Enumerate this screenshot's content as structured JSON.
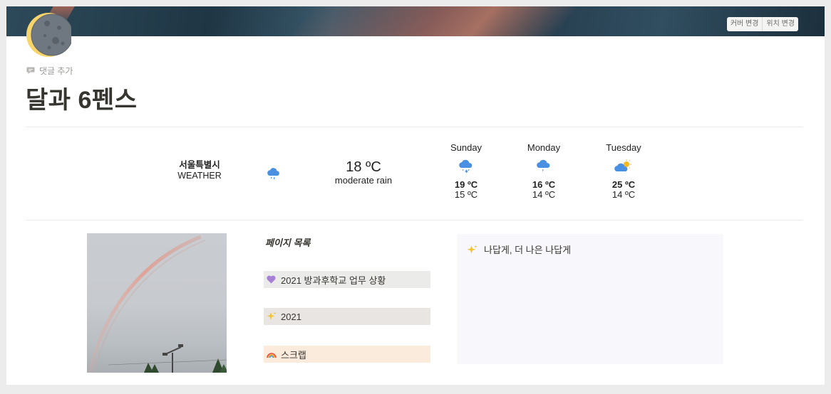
{
  "cover": {
    "change_cover_label": "커버 변경",
    "reposition_label": "위치 변경"
  },
  "page": {
    "icon": "moon-icon",
    "comment_label": "댓글 추가",
    "title": "달과 6펜스"
  },
  "weather": {
    "city": "서울특별시",
    "widget_label": "WEATHER",
    "current": {
      "icon": "rain-cloud-icon",
      "temperature": "18 ºC",
      "description": "moderate rain"
    },
    "forecast": [
      {
        "day": "Sunday",
        "icon": "snow-rain-cloud-icon",
        "high": "19 ºC",
        "low": "15 ºC"
      },
      {
        "day": "Monday",
        "icon": "rain-cloud-icon",
        "high": "16 ºC",
        "low": "14 ºC"
      },
      {
        "day": "Tuesday",
        "icon": "sun-cloud-icon",
        "high": "25 ºC",
        "low": "14 ºC"
      }
    ]
  },
  "toc": {
    "title": "페이지 목록",
    "items": [
      {
        "icon": "purple-heart-icon",
        "label": "2021 방과후학교 업무 상황",
        "bg": "#ebebea"
      },
      {
        "icon": "sparkles-icon",
        "label": "2021",
        "bg": "#e9e5e3"
      },
      {
        "icon": "rainbow-icon",
        "label": "스크랩",
        "bg": "#faebdd"
      }
    ]
  },
  "callout": {
    "icon": "sparkles-icon",
    "text": "나답게, 더 나은 나답게"
  },
  "photo": {
    "subject": "rainbow-photo"
  },
  "colors": {
    "accent_weather": "#4a90e2",
    "callout_bg": "#f8f7fb",
    "title": "#37352f"
  }
}
